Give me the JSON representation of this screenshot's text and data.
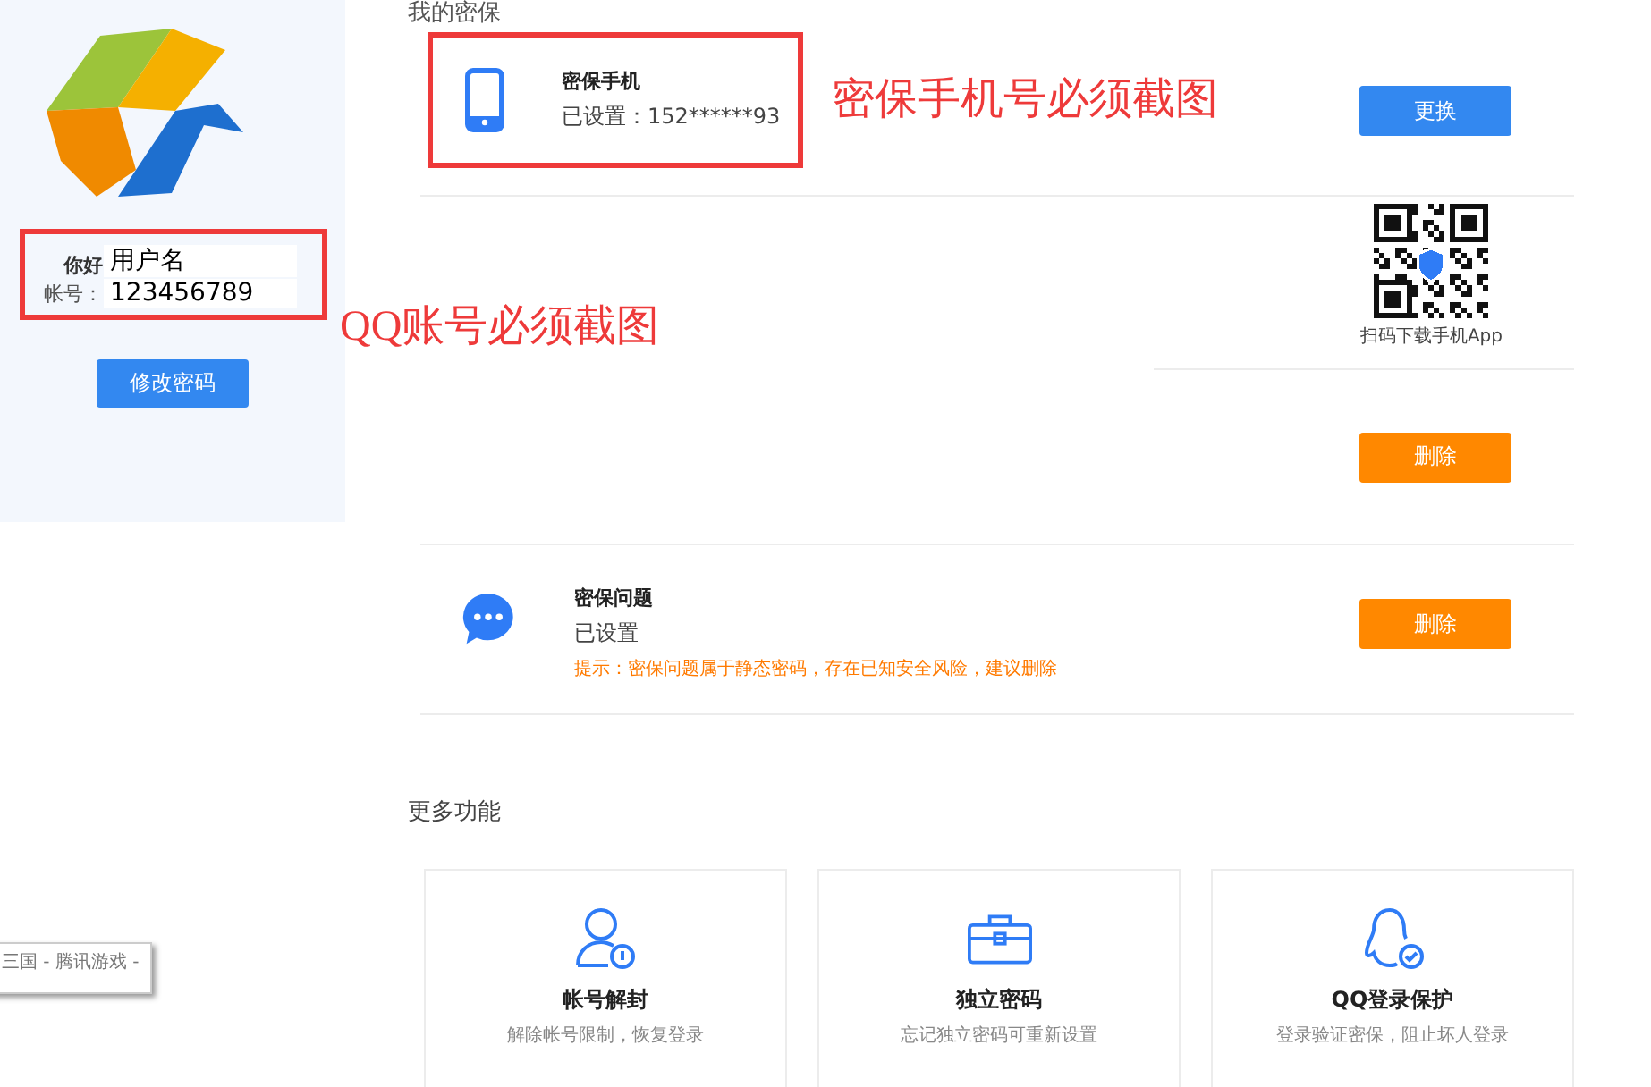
{
  "sidebar": {
    "greeting": "你好",
    "username": "用户名",
    "account_label": "帐号：",
    "account": "123456789",
    "change_password_button": "修改密码"
  },
  "section_title": "我的密保",
  "security_items": [
    {
      "kind": "phone",
      "title": "密保手机",
      "status": "已设置：152******93",
      "button": {
        "label": "更换",
        "kind": "primary"
      },
      "annotation": "密保手机号必须截图"
    },
    {
      "kind": "app",
      "qr_caption": "扫码下载手机App"
    },
    {
      "kind": "blank",
      "button": {
        "label": "删除",
        "kind": "danger"
      }
    },
    {
      "kind": "question",
      "title": "密保问题",
      "status": "已设置",
      "hint": "提示：密保问题属于静态密码，存在已知安全风险，建议删除",
      "button": {
        "label": "删除",
        "kind": "danger"
      }
    }
  ],
  "account_annotation": "QQ账号必须截图",
  "more_title": "更多功能",
  "features": [
    {
      "kind": "unlock",
      "title": "帐号解封",
      "desc": "解除帐号限制，恢复登录"
    },
    {
      "kind": "toolbox",
      "title": "独立密码",
      "desc": "忘记独立密码可重新设置"
    },
    {
      "kind": "qq",
      "title": "QQ登录保护",
      "desc": "登录验证密保，阻止坏人登录"
    }
  ],
  "tooltip": "三国 - 腾讯游戏 -"
}
